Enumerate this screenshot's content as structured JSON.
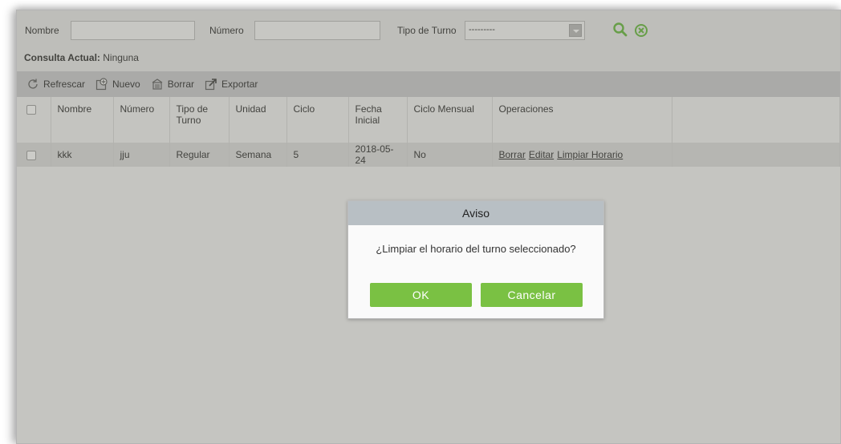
{
  "search": {
    "nombre_label": "Nombre",
    "nombre_value": "",
    "numero_label": "Número",
    "numero_value": "",
    "tipo_label": "Tipo de Turno",
    "tipo_value": "---------"
  },
  "consulta": {
    "label": "Consulta Actual:",
    "value": "Ninguna"
  },
  "toolbar": {
    "refrescar": "Refrescar",
    "nuevo": "Nuevo",
    "borrar": "Borrar",
    "exportar": "Exportar"
  },
  "table": {
    "headers": [
      "Nombre",
      "Número",
      "Tipo de Turno",
      "Unidad",
      "Ciclo",
      "Fecha Inicial",
      "Ciclo Mensual",
      "Operaciones"
    ],
    "rows": [
      {
        "nombre": "kkk",
        "numero": "jju",
        "tipo": "Regular",
        "unidad": "Semana",
        "ciclo": "5",
        "fecha": "2018-05-24",
        "ciclo_mensual": "No",
        "op_borrar": "Borrar",
        "op_editar": "Editar",
        "op_limpiar": "Limpiar Horario"
      }
    ]
  },
  "dialog": {
    "title": "Aviso",
    "message": "¿Limpiar el horario del turno seleccionado?",
    "ok": "OK",
    "cancel": "Cancelar"
  },
  "colors": {
    "accent_green": "#7ac143",
    "search_icon": "#5cb531"
  },
  "icons": [
    "search-icon",
    "clear-icon",
    "refresh-icon",
    "new-icon",
    "delete-icon",
    "export-icon",
    "dropdown-arrow-icon"
  ]
}
